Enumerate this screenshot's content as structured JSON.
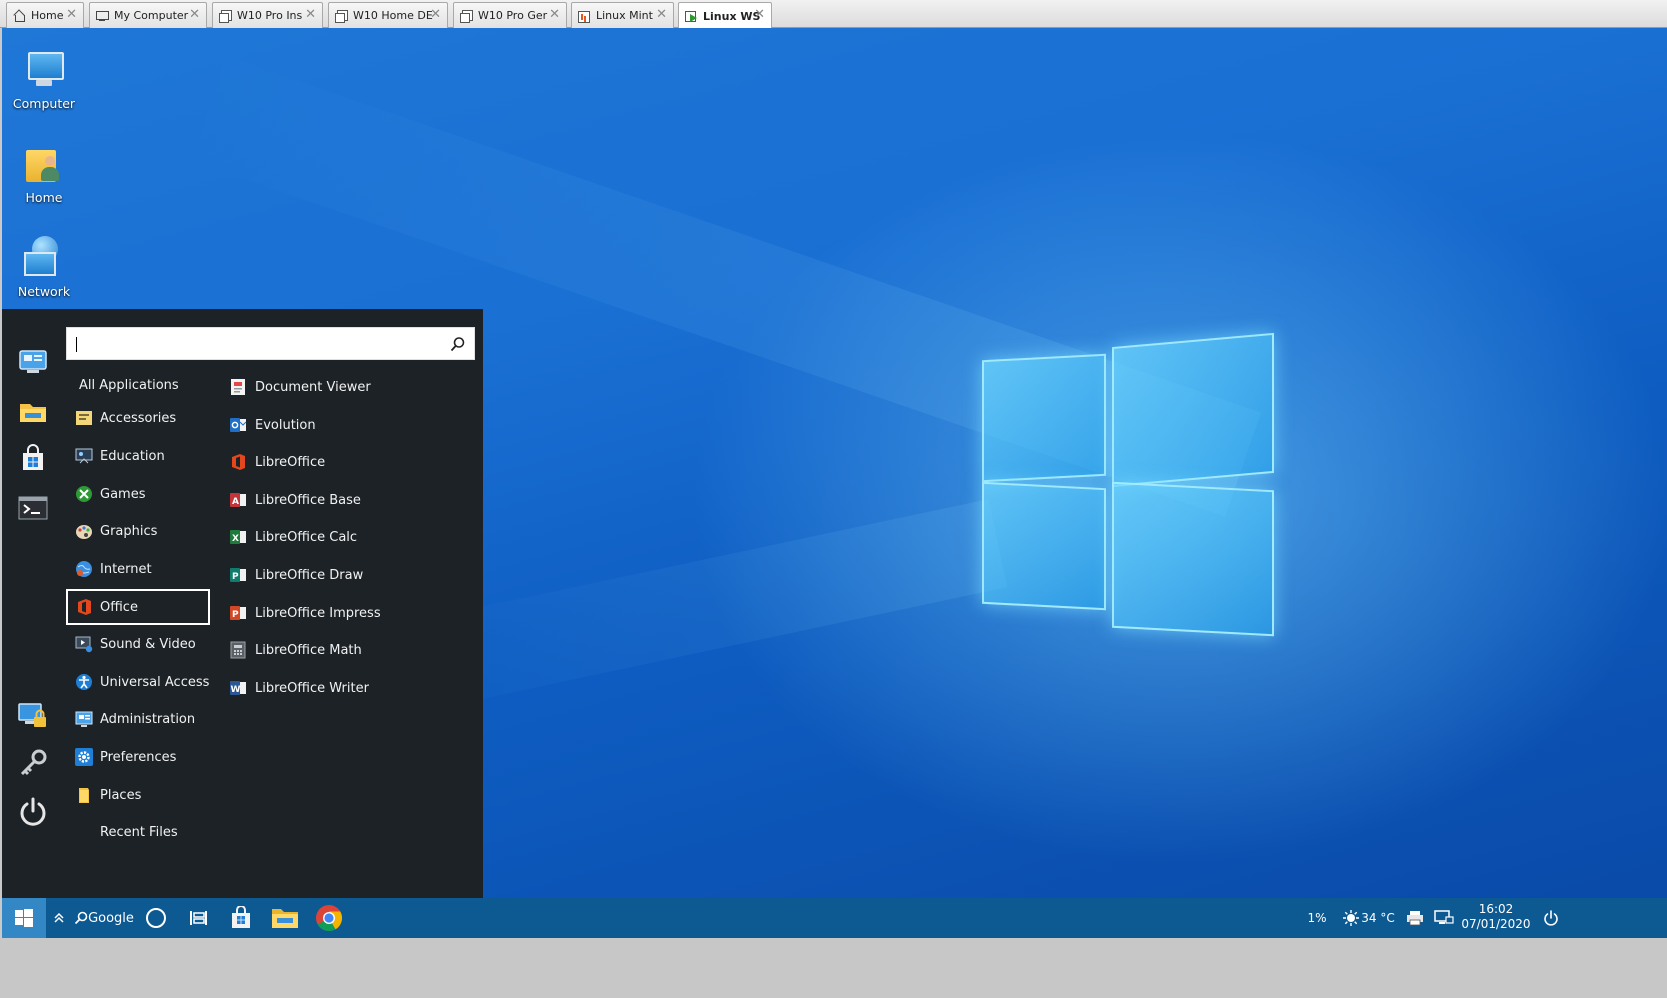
{
  "tabs": [
    {
      "label": "Home",
      "icon": "home-icon"
    },
    {
      "label": "My Computer",
      "icon": "monitor-icon"
    },
    {
      "label": "W10 Pro Ins",
      "icon": "vm-icon"
    },
    {
      "label": "W10 Home DE",
      "icon": "vm-icon"
    },
    {
      "label": "W10 Pro Ger",
      "icon": "vm-icon"
    },
    {
      "label": "Linux Mint",
      "icon": "vm-bar-icon"
    },
    {
      "label": "Linux WS",
      "icon": "vm-running-icon",
      "active": true
    }
  ],
  "tab_close_glyph": "✕",
  "desktop_icons": [
    {
      "label": "Computer",
      "icon": "computer-icon"
    },
    {
      "label": "Home",
      "icon": "home-folder-icon"
    },
    {
      "label": "Network",
      "icon": "network-icon"
    }
  ],
  "menu": {
    "search": {
      "value": "",
      "placeholder": ""
    },
    "sidebar_icons": [
      "system-settings-icon",
      "file-manager-icon",
      "software-store-icon",
      "terminal-icon",
      "lock-screen-icon",
      "keyring-icon",
      "power-icon"
    ],
    "categories": [
      {
        "label": "All Applications"
      },
      {
        "label": "Accessories"
      },
      {
        "label": "Education"
      },
      {
        "label": "Games"
      },
      {
        "label": "Graphics"
      },
      {
        "label": "Internet"
      },
      {
        "label": "Office",
        "selected": true
      },
      {
        "label": "Sound & Video"
      },
      {
        "label": "Universal Access"
      },
      {
        "label": "Administration"
      },
      {
        "label": "Preferences"
      },
      {
        "label": "Places"
      },
      {
        "label": "Recent Files"
      }
    ],
    "apps": [
      {
        "label": "Document Viewer",
        "icon": "document-viewer-icon"
      },
      {
        "label": "Evolution",
        "icon": "evolution-icon"
      },
      {
        "label": "LibreOffice",
        "icon": "libreoffice-icon"
      },
      {
        "label": "LibreOffice Base",
        "icon": "base-icon"
      },
      {
        "label": "LibreOffice Calc",
        "icon": "calc-icon"
      },
      {
        "label": "LibreOffice Draw",
        "icon": "draw-icon"
      },
      {
        "label": "LibreOffice Impress",
        "icon": "impress-icon"
      },
      {
        "label": "LibreOffice Math",
        "icon": "math-icon"
      },
      {
        "label": "LibreOffice Writer",
        "icon": "writer-icon"
      }
    ]
  },
  "taskbar": {
    "search_label": "Google",
    "battery": "1%",
    "weather": "34 °C",
    "time": "16:02",
    "date": "07/01/2020"
  },
  "colors": {
    "menu_bg": "#1c2226",
    "taskbar_bg": "#0d5a93",
    "start_button_bg": "#3287c4",
    "desktop_blue": "#1a6fd3"
  }
}
